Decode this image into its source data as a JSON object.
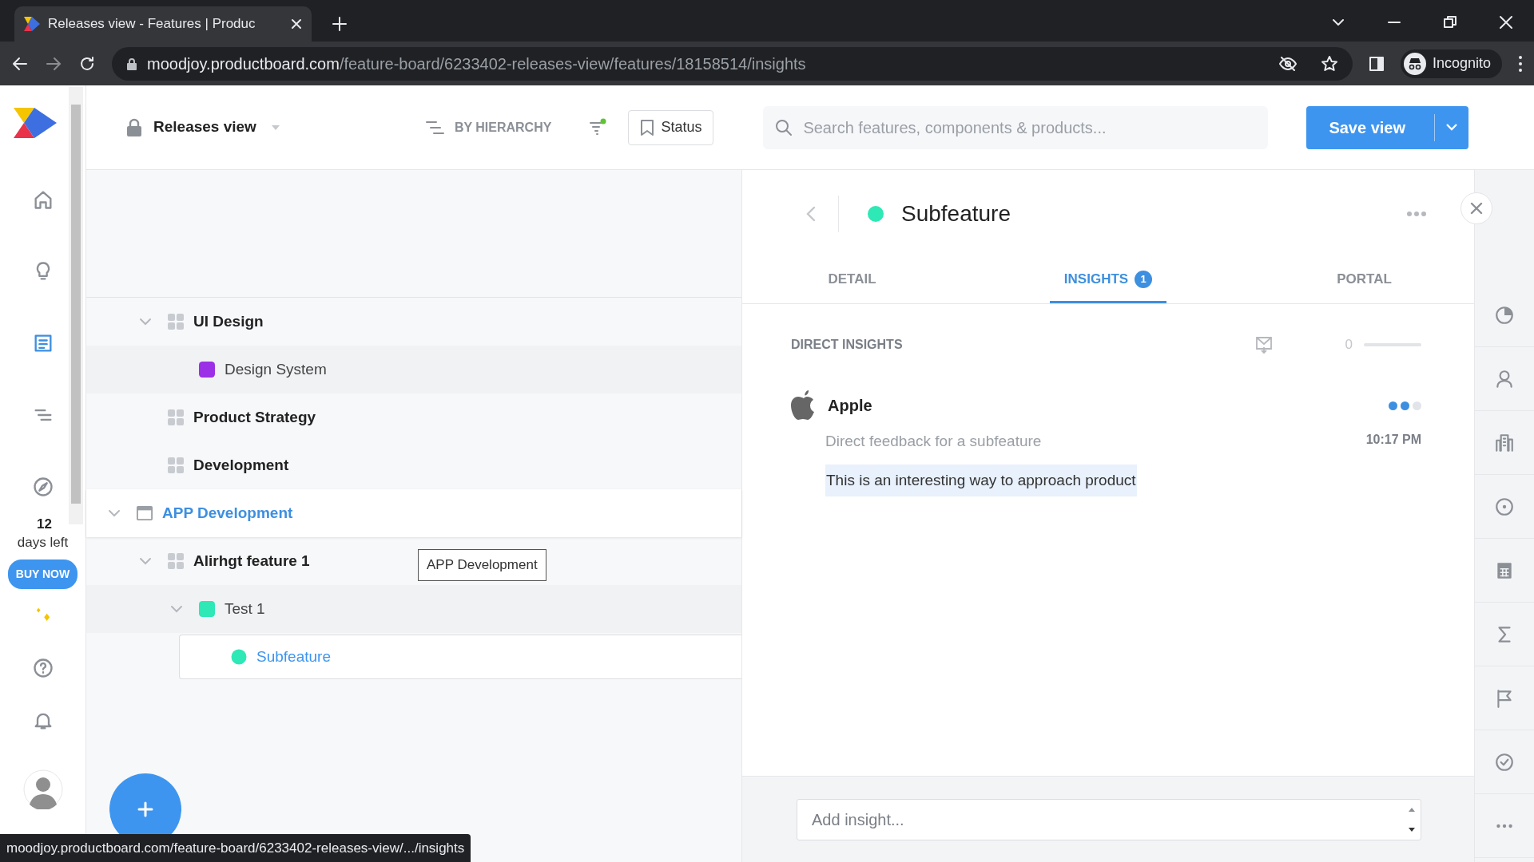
{
  "browser": {
    "tab_title": "Releases view - Features | Produc",
    "url_host": "moodjoy.productboard.com",
    "url_path": "/feature-board/6233402-releases-view/features/18158514/insights",
    "profile": "Incognito"
  },
  "sidebar": {
    "nav": [
      {
        "selected": false
      },
      {
        "selected": false
      },
      {
        "selected": true
      },
      {
        "selected": false
      },
      {
        "selected": false
      }
    ],
    "trial": {
      "days": "12",
      "label": "days left",
      "button": "BUY NOW"
    }
  },
  "toolbar": {
    "view_name": "Releases view",
    "grouping": "BY HIERARCHY",
    "filter_active": true,
    "status_button": "Status",
    "search": {
      "placeholder": "Search features, components & products..."
    },
    "save_button": "Save view"
  },
  "tree": {
    "partial_children": [
      {
        "label": "UI Design",
        "kind": "component",
        "expanded": true,
        "selected": false,
        "children": [
          {
            "label": "Design System",
            "kind": "feature",
            "color": "#9b30e6",
            "selected": false
          }
        ]
      },
      {
        "label": "Product Strategy",
        "kind": "component",
        "selected": false
      },
      {
        "label": "Development",
        "kind": "component",
        "selected": false
      }
    ],
    "items": [
      {
        "label": "APP Development",
        "kind": "product",
        "expanded": true,
        "selected": false,
        "children": [
          {
            "label": "Alirhgt feature 1",
            "kind": "component",
            "expanded": true,
            "selected": false,
            "children": [
              {
                "label": "Test 1",
                "kind": "feature",
                "color": "#2ee8b6",
                "expanded": true,
                "selected": false,
                "children": [
                  {
                    "label": "Subfeature",
                    "kind": "subfeature",
                    "color": "#2ee8b6",
                    "selected": true
                  }
                ]
              }
            ]
          }
        ]
      }
    ],
    "tooltip": "APP Development"
  },
  "detail": {
    "title": "Subfeature",
    "tabs": [
      {
        "label": "DETAIL",
        "selected": false
      },
      {
        "label": "INSIGHTS",
        "badge": "1",
        "selected": true
      },
      {
        "label": "PORTAL",
        "selected": false
      }
    ],
    "section": "DIRECT INSIGHTS",
    "score": {
      "value": "0",
      "level": 0
    },
    "insights": [
      {
        "company": "Apple",
        "level": 0.67,
        "title": "Direct feedback for a subfeature",
        "time": "10:17 PM",
        "excerpt": "This is an interesting way to approach product"
      }
    ],
    "add_insight": {
      "placeholder": "Add insight..."
    }
  },
  "status_url": "moodjoy.productboard.com/feature-board/6233402-releases-view/.../insights"
}
